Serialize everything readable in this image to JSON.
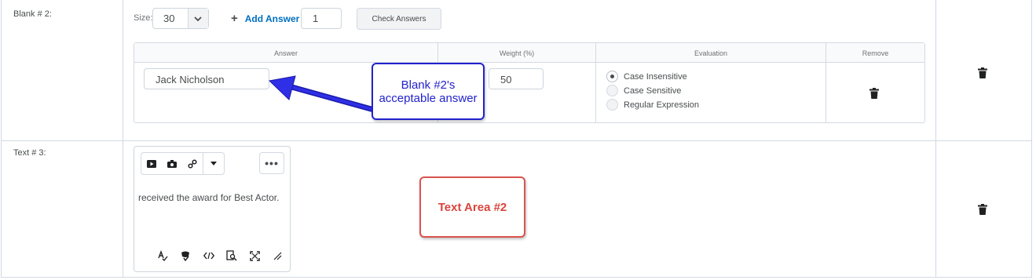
{
  "rows": {
    "blank2_label": "Blank # 2:",
    "text3_label": "Text # 3:"
  },
  "blank_controls": {
    "size_label": "Size:",
    "size_value": "30",
    "add_answer_label": "Add Answer",
    "answer_count": "1",
    "check_answers_label": "Check Answers"
  },
  "answers_table": {
    "headers": [
      "Answer",
      "Weight (%)",
      "Evaluation",
      "Remove"
    ],
    "answer_value": "Jack Nicholson",
    "weight_value": "50",
    "evaluation_options": [
      {
        "label": "Case Insensitive",
        "selected": true
      },
      {
        "label": "Case Sensitive",
        "selected": false
      },
      {
        "label": "Regular Expression",
        "selected": false
      }
    ]
  },
  "callouts": {
    "blue_text": "Blank #2's acceptable answer",
    "red_text": "Text Area #2"
  },
  "editor": {
    "content": "received the award for Best Actor.",
    "toolbar_icons": [
      "video-icon",
      "camera-icon",
      "link-icon",
      "dropdown-caret-icon",
      "more-options-icon"
    ],
    "more_label": "•••",
    "footer_icons": [
      "spellcheck-icon",
      "accessibility-check-icon",
      "source-code-icon",
      "find-replace-icon",
      "fullscreen-icon",
      "resize-handle-icon"
    ]
  },
  "colors": {
    "accent_link": "#006fbf",
    "callout_blue": "#2222cc",
    "callout_red": "#d9453d",
    "border": "#d3d9e3"
  }
}
